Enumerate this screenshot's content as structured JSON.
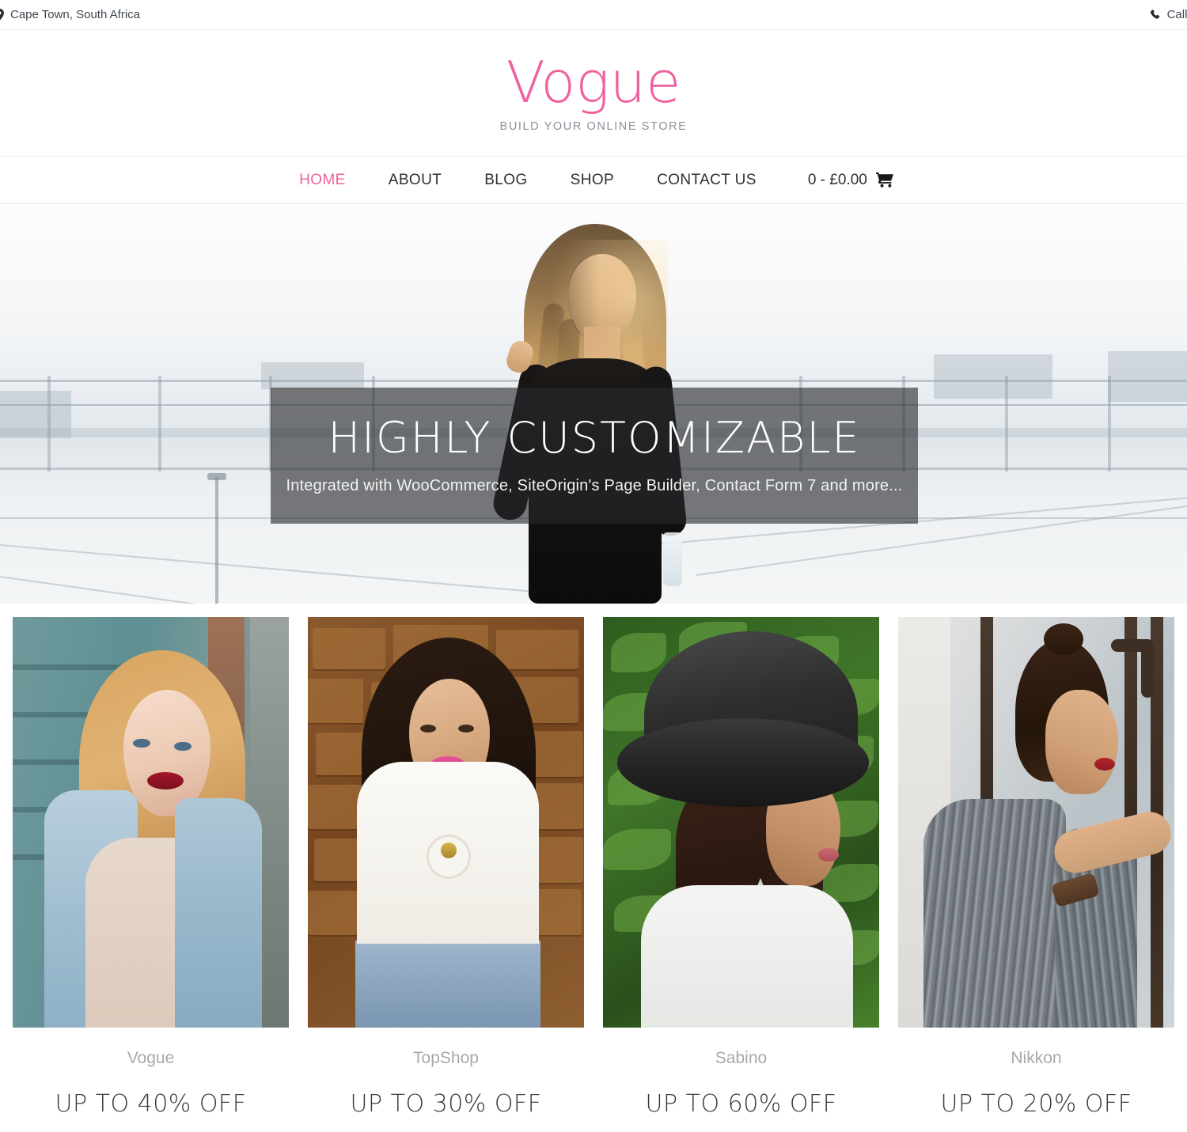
{
  "topbar": {
    "location_icon": "map-marker-icon",
    "location": "Cape Town, South Africa",
    "phone_icon": "phone-icon",
    "phone": "Call Us: +"
  },
  "brand": {
    "name": "Vogue",
    "tagline": "BUILD YOUR ONLINE STORE",
    "accent_color": "#f0609f"
  },
  "nav": {
    "items": [
      {
        "label": "HOME",
        "active": true
      },
      {
        "label": "ABOUT",
        "active": false
      },
      {
        "label": "BLOG",
        "active": false
      },
      {
        "label": "SHOP",
        "active": false
      },
      {
        "label": "CONTACT US",
        "active": false
      }
    ],
    "cart": {
      "label": "0 - £0.00",
      "icon": "shopping-cart-icon",
      "count": "0",
      "total": "£0.00"
    }
  },
  "hero": {
    "title": "HIGHLY CUSTOMIZABLE",
    "subtitle": "Integrated with WooCommerce, SiteOrigin's Page Builder, Contact Form 7 and more...",
    "overlay_color": "rgba(40,42,45,0.62)"
  },
  "products": [
    {
      "brand": "Vogue",
      "offer": "UP TO 40% OFF"
    },
    {
      "brand": "TopShop",
      "offer": "UP TO 30% OFF"
    },
    {
      "brand": "Sabino",
      "offer": "UP TO 60% OFF"
    },
    {
      "brand": "Nikkon",
      "offer": "UP TO 20% OFF"
    }
  ]
}
